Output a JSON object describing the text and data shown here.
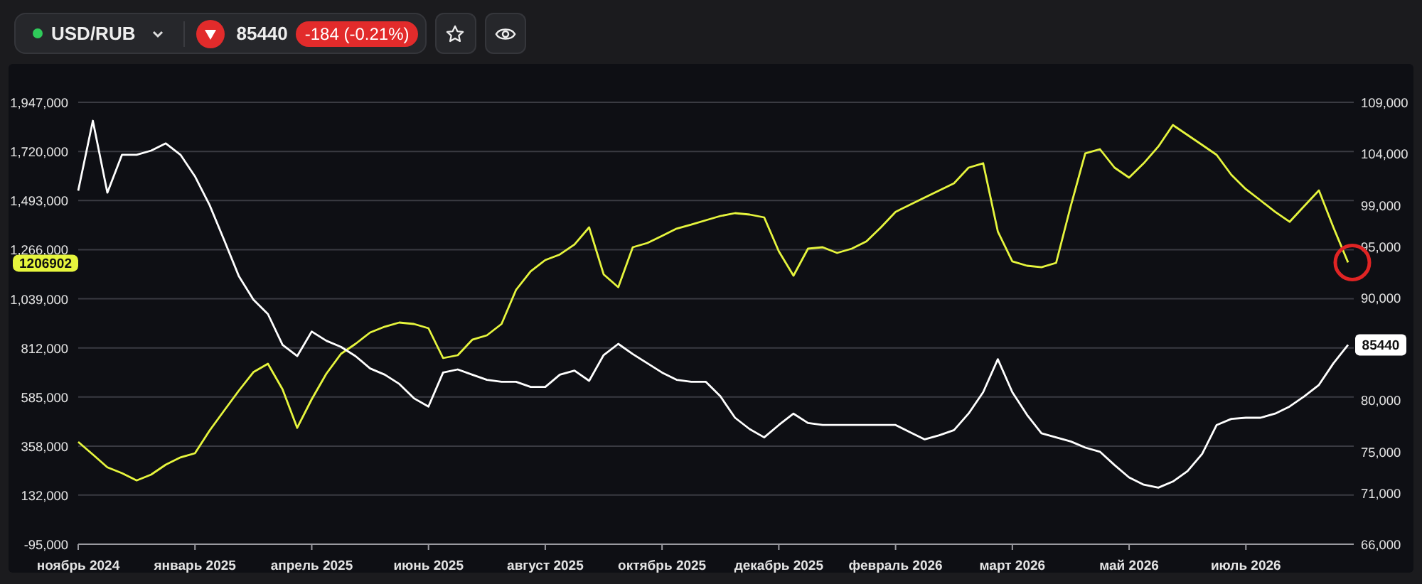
{
  "ticker": {
    "symbol": "USD/RUB",
    "price": "85440",
    "change": "-184 (-0.21%)"
  },
  "chart": {
    "left_badge": "1206902",
    "right_badge": "85440",
    "marker": {
      "kind": "circle"
    },
    "chart_data": {
      "type": "line",
      "grid": true,
      "categories": [
        "ноябрь 2024",
        null,
        null,
        null,
        null,
        null,
        null,
        null,
        "январь 2025",
        null,
        null,
        null,
        null,
        null,
        null,
        null,
        "апрель 2025",
        null,
        null,
        null,
        null,
        null,
        null,
        null,
        "июнь 2025",
        null,
        null,
        null,
        null,
        null,
        null,
        null,
        "август 2025",
        null,
        null,
        null,
        null,
        null,
        null,
        null,
        "октябрь 2025",
        null,
        null,
        null,
        null,
        null,
        null,
        null,
        "декабрь 2025",
        null,
        null,
        null,
        null,
        null,
        null,
        null,
        "февраль 2026",
        null,
        null,
        null,
        null,
        null,
        null,
        null,
        "март 2026",
        null,
        null,
        null,
        null,
        null,
        null,
        null,
        "май 2026",
        null,
        null,
        null,
        null,
        null,
        null,
        null,
        "июль 2026",
        null,
        null,
        null,
        null,
        null,
        null,
        null
      ],
      "ylim": [
        -95000,
        1947000
      ],
      "yticks": [
        {
          "value": 1947000,
          "label": "1,947,000"
        },
        {
          "value": 1720000,
          "label": "1,720,000"
        },
        {
          "value": 1493000,
          "label": "1,493,000"
        },
        {
          "value": 1266000,
          "label": "1,266,000"
        },
        {
          "value": 1039000,
          "label": "1,039,000"
        },
        {
          "value": 812000,
          "label": "812,000"
        },
        {
          "value": 585000,
          "label": "585,000"
        },
        {
          "value": 358000,
          "label": "358,000"
        },
        {
          "value": 132000,
          "label": "132,000"
        },
        {
          "value": -95000,
          "label": "-95,000"
        }
      ],
      "y2lim": [
        66000,
        109000
      ],
      "y2ticks": [
        {
          "value": 109000,
          "label": "109,000"
        },
        {
          "value": 104000,
          "label": "104,000"
        },
        {
          "value": 99000,
          "label": "99,000"
        },
        {
          "value": 95000,
          "label": "95,000"
        },
        {
          "value": 90000,
          "label": "90,000"
        },
        {
          "value": 80000,
          "label": "80,000"
        },
        {
          "value": 75000,
          "label": "75,000"
        },
        {
          "value": 71000,
          "label": "71,000"
        },
        {
          "value": 66000,
          "label": "66,000"
        }
      ],
      "series": [
        {
          "color": "#e6f53d",
          "values": [
            378000,
            319000,
            260000,
            233000,
            200000,
            227000,
            273000,
            306000,
            325000,
            430000,
            522000,
            614000,
            700000,
            739000,
            621000,
            443000,
            575000,
            693000,
            785000,
            831000,
            883000,
            910000,
            929000,
            923000,
            903000,
            765000,
            778000,
            850000,
            870000,
            923000,
            1080000,
            1166000,
            1218000,
            1244000,
            1290000,
            1369000,
            1152000,
            1093000,
            1277000,
            1297000,
            1330000,
            1363000,
            1382000,
            1402000,
            1422000,
            1435000,
            1428000,
            1415000,
            1258000,
            1146000,
            1271000,
            1277000,
            1251000,
            1271000,
            1304000,
            1369000,
            1441000,
            1474000,
            1507000,
            1540000,
            1573000,
            1645000,
            1665000,
            1350000,
            1212000,
            1192000,
            1185000,
            1205000,
            1468000,
            1711000,
            1730000,
            1645000,
            1599000,
            1665000,
            1743000,
            1842000,
            1796000,
            1750000,
            1704000,
            1612000,
            1546000,
            1494000,
            1441000,
            1395000,
            1468000,
            1540000,
            1369000,
            1207000
          ]
        },
        {
          "color": "#ffffff",
          "axis": "y2",
          "values": [
            100400,
            107200,
            100200,
            103900,
            103900,
            104300,
            105000,
            103900,
            101800,
            99000,
            95600,
            92100,
            89800,
            88400,
            85400,
            84300,
            86700,
            85800,
            85200,
            84300,
            83100,
            82500,
            81600,
            80200,
            79400,
            82700,
            83000,
            82500,
            82000,
            81800,
            81800,
            81300,
            81300,
            82500,
            82900,
            81900,
            84400,
            85500,
            84500,
            83600,
            82700,
            82000,
            81800,
            81800,
            80400,
            78300,
            77200,
            76400,
            77600,
            78700,
            77800,
            77600,
            77600,
            77600,
            77600,
            77600,
            77600,
            76900,
            76200,
            76600,
            77100,
            78700,
            80800,
            84000,
            80800,
            78600,
            76800,
            76400,
            76000,
            75400,
            75000,
            73700,
            72500,
            71800,
            71500,
            72100,
            73100,
            74800,
            77600,
            78200,
            78300,
            78300,
            78700,
            79400,
            80400,
            81500,
            83600,
            85400
          ]
        }
      ]
    }
  }
}
